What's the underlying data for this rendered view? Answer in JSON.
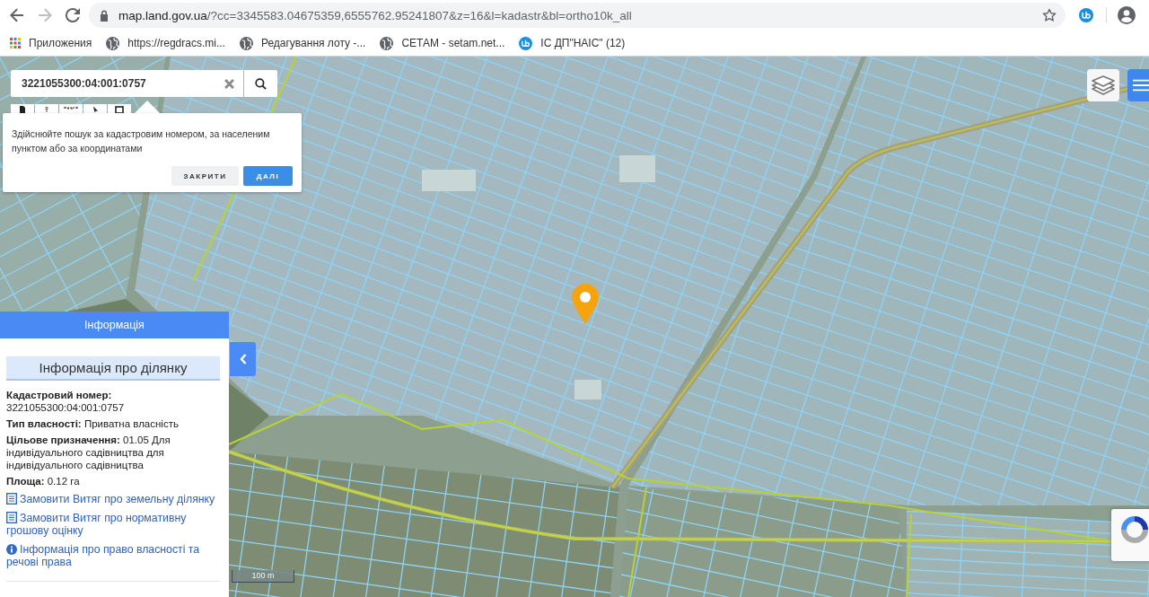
{
  "browser": {
    "nav_buttons": [
      {
        "kind": "back",
        "disabled": false
      },
      {
        "kind": "forward",
        "disabled": true
      },
      {
        "kind": "reload",
        "disabled": false
      }
    ],
    "url": {
      "host": "map.land.gov.ua",
      "path": "/?cc=3345583.04675359,6555762.95241807&z=16&l=kadastr&bl=ortho10k_all"
    },
    "bookmarks": [
      {
        "kind": "apps",
        "label": "Приложения"
      },
      {
        "kind": "globe",
        "label": "https://regdracs.mi..."
      },
      {
        "kind": "globe",
        "label": "Редагування лоту -..."
      },
      {
        "kind": "globe",
        "label": "СЕТАМ - setam.net..."
      },
      {
        "kind": "extension",
        "label": "ІС ДП\"НАІС\" (12)"
      }
    ]
  },
  "map": {
    "search": {
      "value": "3221055300:04:001:0757"
    },
    "hint_popup": {
      "text": "Здійснюйте пошук за кадастровим номером, за населеним пунктом або за координатами",
      "buttons": [
        {
          "kind": "secondary",
          "label": "ЗАКРИТИ"
        },
        {
          "kind": "primary",
          "label": "ДАЛІ"
        }
      ]
    },
    "scale_label": "100 m"
  },
  "info_panel": {
    "title": "Інформація",
    "section_title": "Інформація про ділянку",
    "fields": [
      "**Кадастровий номер:** 3221055300:04:001:0757",
      "**Тип власності:** Приватна власність",
      "**Цільове призначення:** 01.05 Для індивідуального садівництва для індивідуального садівництва",
      "**Площа:** 0.12 га"
    ],
    "links": [
      {
        "kind": "document",
        "label": "Замовити Витяг про земельну ділянку"
      },
      {
        "kind": "document",
        "label": "Замовити Витяг про нормативну грошову оцінку"
      },
      {
        "kind": "info",
        "label": "Інформація про право власності та речові права"
      }
    ]
  }
}
